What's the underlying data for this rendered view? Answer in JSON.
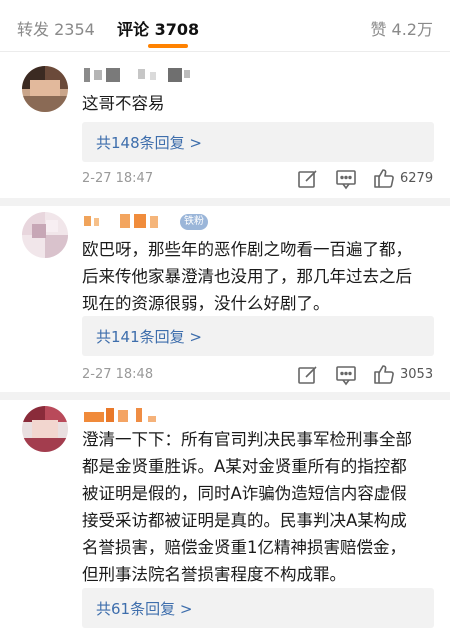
{
  "tabs": {
    "repost": "转发 2354",
    "comment": "评论 3708",
    "like": "赞 4.2万",
    "accent_color": "#ff8200"
  },
  "comments": [
    {
      "text_lines": [
        "这哥不容易"
      ],
      "replies_label": "共148条回复 >",
      "time": "2-27 18:47",
      "like_count": "6279",
      "icons": [
        "edit-icon",
        "comment-icon",
        "thumbs-up-icon"
      ]
    },
    {
      "badge": "铁粉",
      "text_lines": [
        "欧巴呀，那些年的恶作剧之吻看一百遍了都，",
        "后来传他家暴澄清也没用了，那几年过去之后",
        "现在的资源很弱，没什么好剧了。"
      ],
      "replies_label": "共141条回复 >",
      "time": "2-27 18:48",
      "like_count": "3053",
      "icons": [
        "edit-icon",
        "comment-icon",
        "thumbs-up-icon"
      ]
    },
    {
      "text_lines": [
        "澄清一下下：所有官司判决民事军检刑事全部",
        "都是金贤重胜诉。A某对金贤重所有的指控都",
        "被证明是假的，同时A诈骗伪造短信内容虚假",
        "接受采访都被证明是真的。民事判决A某构成",
        "名誉损害，赔偿金贤重1亿精神损害赔偿金，",
        "但刑事法院名誉损害程度不构成罪。"
      ],
      "replies_label": "共61条回复 >"
    }
  ],
  "colors": {
    "link": "#3e6eac",
    "reply_bg": "#f2f2f2",
    "meta": "#9a9a9a"
  }
}
